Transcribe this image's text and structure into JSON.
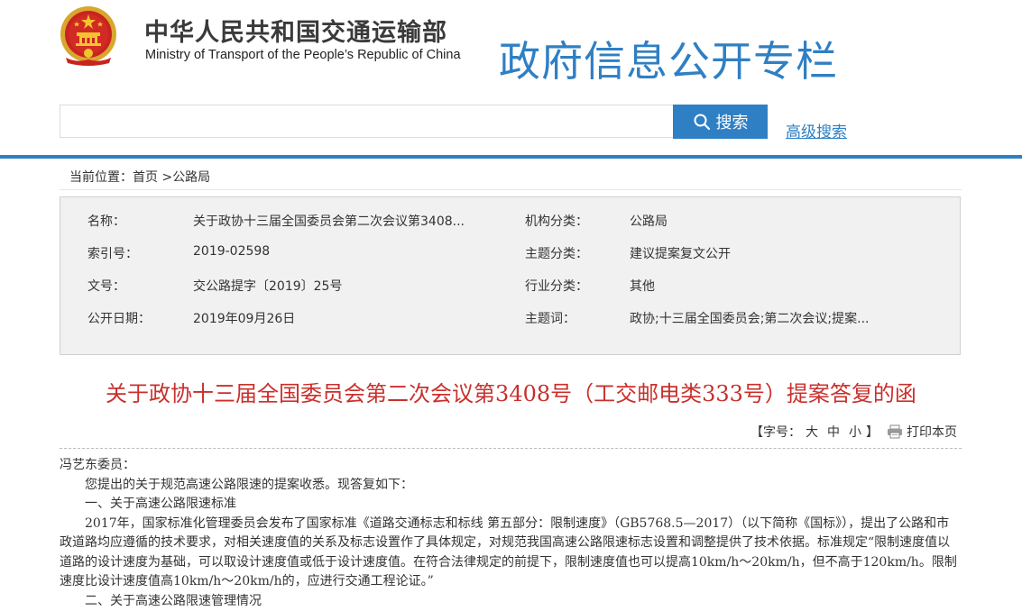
{
  "header": {
    "ministry_cn": "中华人民共和国交通运输部",
    "ministry_en": "Ministry of Transport of the People’s Republic of China",
    "column_title": "政府信息公开专栏"
  },
  "search": {
    "placeholder": "",
    "value": "",
    "button_label": "搜索",
    "advanced_label": "高级搜索"
  },
  "breadcrumb": {
    "label": "当前位置：",
    "home": "首页",
    "separator": ">",
    "current": "公路局"
  },
  "meta": {
    "name_label": "名称：",
    "name_value": "关于政协十三届全国委员会第二次会议第3408...",
    "index_label": "索引号：",
    "index_value": "2019-02598",
    "docno_label": "文号：",
    "docno_value": "交公路提字〔2019〕25号",
    "date_label": "公开日期：",
    "date_value": "2019年09月26日",
    "org_label": "机构分类：",
    "org_value": "公路局",
    "topic_label": "主题分类：",
    "topic_value": "建议提案复文公开",
    "industry_label": "行业分类：",
    "industry_value": "其他",
    "keywords_label": "主题词：",
    "keywords_value": "政协;十三届全国委员会;第二次会议;提案..."
  },
  "document": {
    "title": "关于政协十三届全国委员会第二次会议第3408号（工交邮电类333号）提案答复的函",
    "fontsize_label": "【字号：",
    "fontsize_large": "大",
    "fontsize_medium": "中",
    "fontsize_small": "小",
    "fontsize_close": "】",
    "print_label": "打印本页",
    "greeting": "冯艺东委员：",
    "para1": "您提出的关于规范高速公路限速的提案收悉。现答复如下：",
    "heading1": "一、关于高速公路限速标准",
    "para2": "2017年，国家标准化管理委员会发布了国家标准《道路交通标志和标线 第五部分：限制速度》（GB5768.5—2017）（以下简称《国标》），提出了公路和市政道路均应遵循的技术要求，对相关速度值的关系及标志设置作了具体规定，对规范我国高速公路限速标志设置和调整提供了技术依据。标准规定“限制速度值以道路的设计速度为基础，可以取设计速度值或低于设计速度值。在符合法律规定的前提下，限制速度值也可以提高10km/h～20km/h，但不高于120km/h。限制速度比设计速度值高10km/h～20km/h的，应进行交通工程论证。”",
    "heading2": "二、关于高速公路限速管理情况"
  },
  "colors": {
    "accent": "#2f7fc4",
    "title_red": "#c9302c",
    "meta_bg": "#f1f1f1"
  }
}
